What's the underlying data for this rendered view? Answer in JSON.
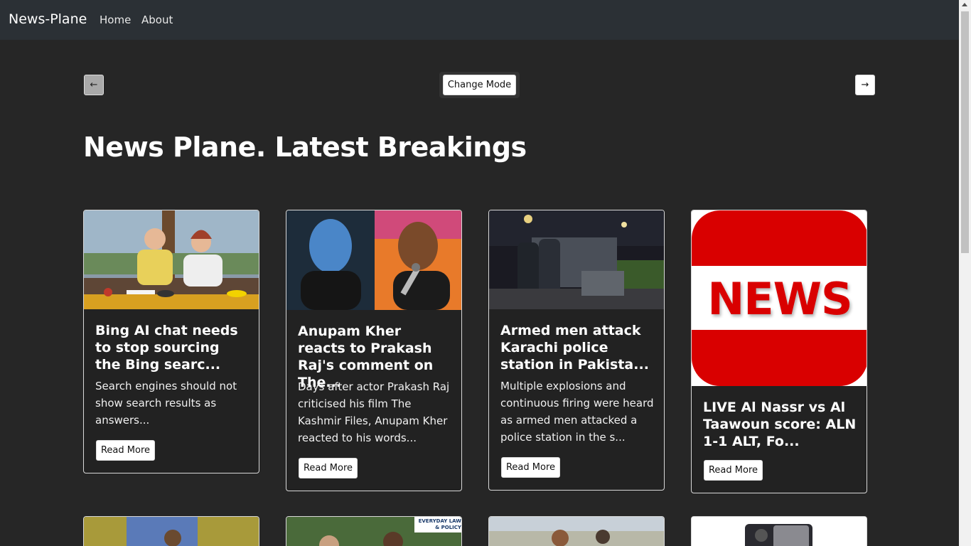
{
  "navbar": {
    "brand": "News-Plane",
    "links": [
      "Home",
      "About"
    ]
  },
  "controls": {
    "prev_label": "←",
    "mode_label": "Change Mode",
    "next_label": "→"
  },
  "page_title": "News Plane. Latest Breakings",
  "cards": [
    {
      "title": "Bing AI chat needs to stop sourcing the Bing searc...",
      "description": "Search engines should not show search results as answers...",
      "button": "Read More",
      "image": "classroom-students-image"
    },
    {
      "title": "Anupam Kher reacts to Prakash Raj's comment on The...",
      "description": "Days after actor Prakash Raj criticised his film The Kashmir Files, Anupam Kher reacted to his words...",
      "button": "Read More",
      "image": "actors-portrait-image"
    },
    {
      "title": "Armed men attack Karachi police station in Pakista...",
      "description": "Multiple explosions and continuous firing were heard as armed men attacked a police station in the s...",
      "button": "Read More",
      "image": "police-night-image"
    },
    {
      "title": "LIVE Al Nassr vs Al Taawoun score: ALN 1-1 ALT, Fo...",
      "description": "",
      "button": "Read More",
      "image": "news-logo-image",
      "logo_text": "NEWS"
    }
  ],
  "second_row_badge": "EVERYDAY LAW & POLICY",
  "colors": {
    "navbar": "#2b3035",
    "background": "#262626",
    "card_border": "#d8d8d8",
    "news_red": "#d90000"
  }
}
